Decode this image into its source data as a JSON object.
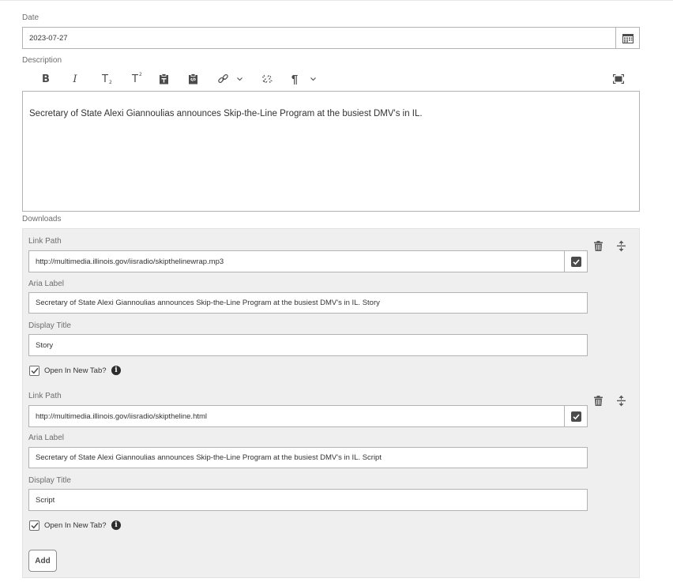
{
  "date": {
    "label": "Date",
    "value": "2023-07-27"
  },
  "description": {
    "label": "Description",
    "text": "Secretary of State Alexi Giannoulias announces Skip-the-Line Program at the busiest DMV's in IL.",
    "toolbar": {
      "bold": "B",
      "italic": "I",
      "subscript": "T",
      "superscript": "T",
      "paragraph": "¶"
    }
  },
  "downloads": {
    "label": "Downloads",
    "items": [
      {
        "link_path_label": "Link Path",
        "link_path": "http://multimedia.illinois.gov/iisradio/skipthelinewrap.mp3",
        "aria_label_label": "Aria Label",
        "aria_label": "Secretary of State Alexi Giannoulias announces Skip-the-Line Program at the busiest DMV's in IL. Story",
        "display_title_label": "Display Title",
        "display_title": "Story",
        "open_new_tab_label": "Open In New Tab?",
        "open_new_tab": true
      },
      {
        "link_path_label": "Link Path",
        "link_path": "http://multimedia.illinois.gov/iisradio/skiptheline.html",
        "aria_label_label": "Aria Label",
        "aria_label": "Secretary of State Alexi Giannoulias announces Skip-the-Line Program at the busiest DMV's in IL. Script",
        "display_title_label": "Display Title",
        "display_title": "Script",
        "open_new_tab_label": "Open In New Tab?",
        "open_new_tab": true
      }
    ],
    "add_label": "Add",
    "info_glyph": "i"
  }
}
